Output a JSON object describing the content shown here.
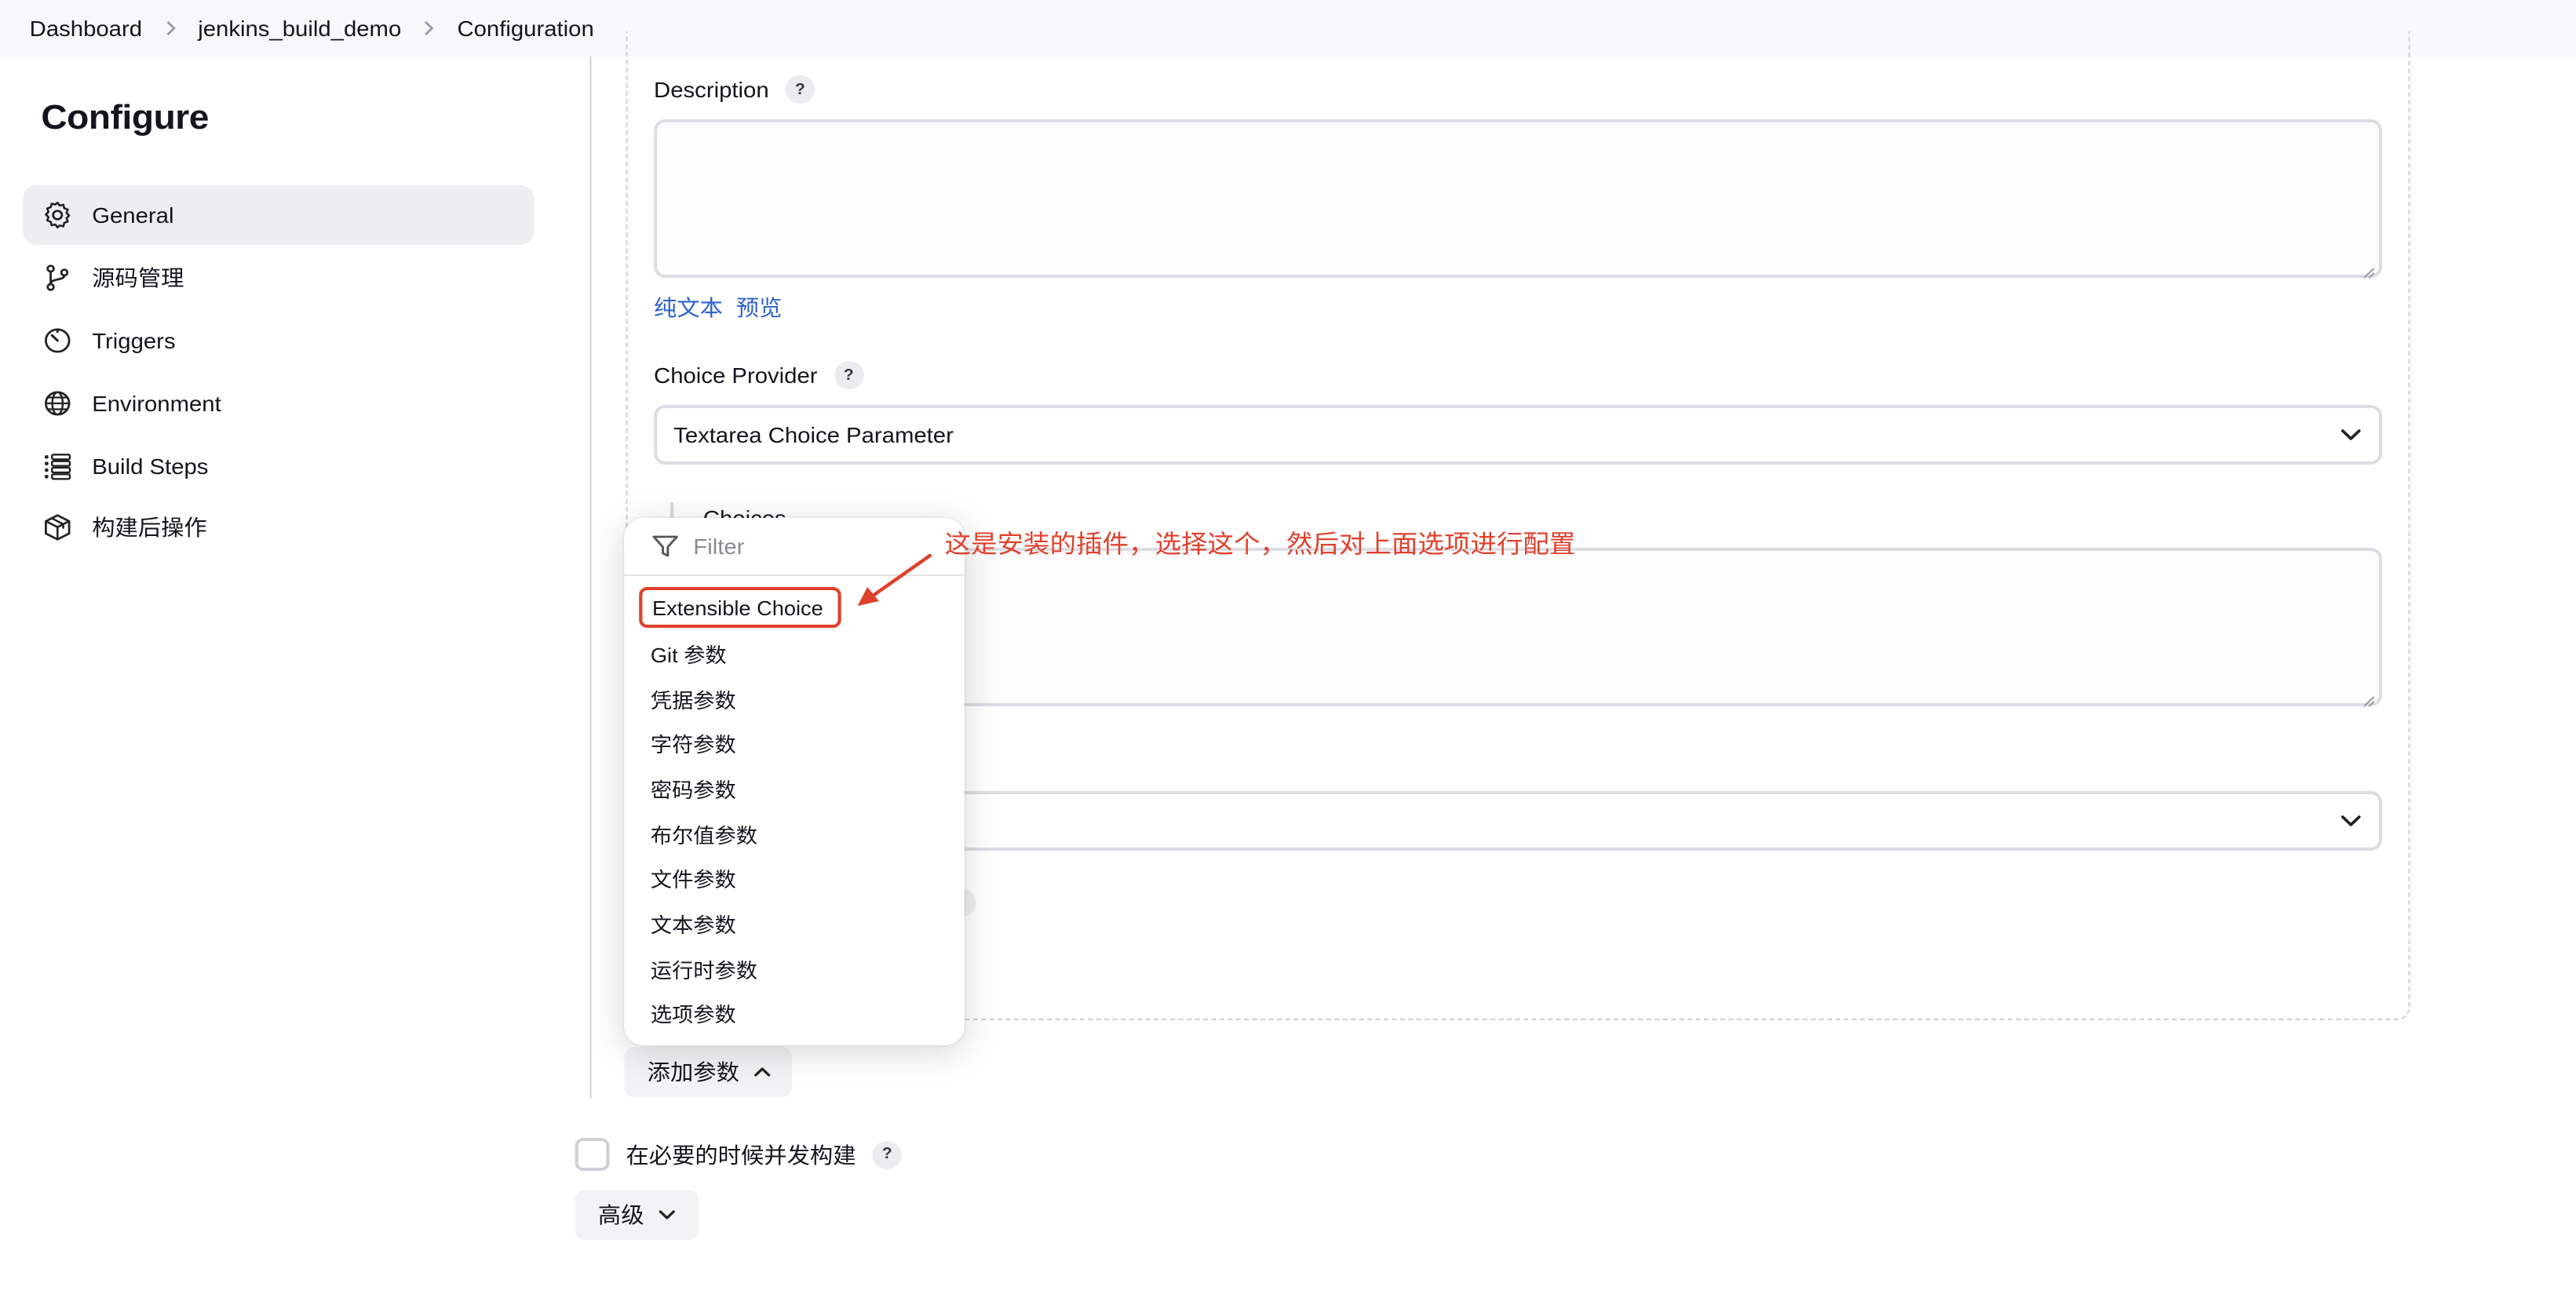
{
  "breadcrumb": [
    "Dashboard",
    "jenkins_build_demo",
    "Configuration"
  ],
  "sidebar": {
    "title": "Configure",
    "items": [
      {
        "label": "General",
        "icon": "gear-icon",
        "active": true
      },
      {
        "label": "源码管理",
        "icon": "branch-icon",
        "active": false
      },
      {
        "label": "Triggers",
        "icon": "timer-icon",
        "active": false
      },
      {
        "label": "Environment",
        "icon": "globe-icon",
        "active": false
      },
      {
        "label": "Build Steps",
        "icon": "list-icon",
        "active": false
      },
      {
        "label": "构建后操作",
        "icon": "package-icon",
        "active": false
      }
    ]
  },
  "form": {
    "description_label": "Description",
    "help": "?",
    "description_value": "",
    "links": [
      "纯文本",
      "预览"
    ],
    "choice_provider_label": "Choice Provider",
    "choice_provider_value": "Textarea Choice Parameter",
    "choices_label": "Choices"
  },
  "dropdown": {
    "filter_placeholder": "Filter",
    "options": [
      "Extensible Choice",
      "Git 参数",
      "凭据参数",
      "字符参数",
      "密码参数",
      "布尔值参数",
      "文件参数",
      "文本参数",
      "运行时参数",
      "选项参数"
    ],
    "highlighted": "Extensible Choice"
  },
  "buttons": {
    "add_parameter": "添加参数",
    "advanced": "高级"
  },
  "concurrent_build_label": "在必要的时候并发构建",
  "annotation": "这是安装的插件，选择这个，然后对上面选项进行配置",
  "colors": {
    "accent_link": "#2c62c9",
    "annotation_red": "#e0412c",
    "active_nav_bg": "#eeeef2"
  }
}
